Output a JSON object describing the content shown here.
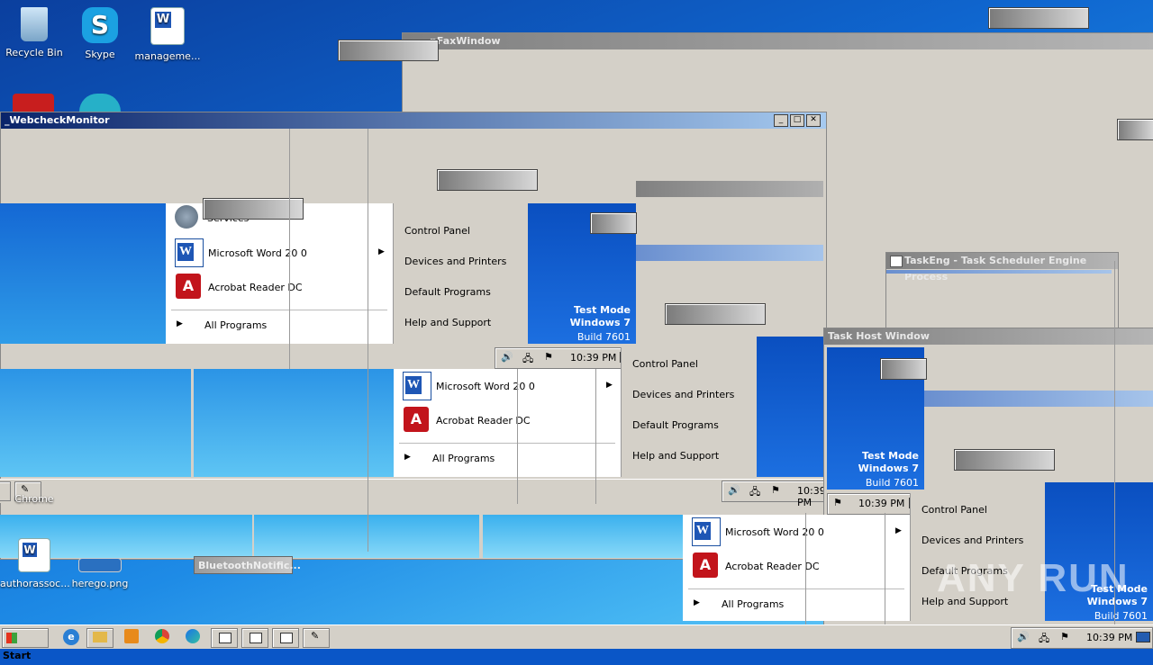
{
  "desktop": {
    "icons": [
      {
        "label": "Recycle Bin",
        "icon": "recycle-bin-icon"
      },
      {
        "label": "Skype",
        "icon": "skype-icon"
      },
      {
        "label": "manageme...",
        "icon": "word-doc-icon"
      },
      {
        "label": "Chrome",
        "icon": "chrome-icon"
      },
      {
        "label": "authorassoc...",
        "icon": "word-doc-icon"
      },
      {
        "label": "herego.png",
        "icon": "image-file-icon"
      }
    ]
  },
  "windows": {
    "fax": {
      "title": "nFaxWindow"
    },
    "webcheck": {
      "title": "_WebcheckMonitor"
    },
    "taskeng": {
      "title": "TaskEng - Task Scheduler Engine Process"
    },
    "taskhost": {
      "title": "Task Host Window"
    },
    "bluetooth": {
      "title": "BluetoothNotific..."
    }
  },
  "start_menu": {
    "services": "Services",
    "word": "Microsoft Word 20 0",
    "acrobat": "Acrobat Reader DC",
    "all_programs": "All Programs",
    "control_panel": "Control Panel",
    "devices": "Devices and Printers",
    "default_programs": "Default Programs",
    "help": "Help and Support"
  },
  "test_mode": {
    "line1": "Test Mode",
    "line2": "Windows 7",
    "line3": "Build 7601"
  },
  "tray": {
    "time": "10:39 PM"
  },
  "taskbar": {
    "start_label": "Start"
  },
  "watermark": {
    "text": "ANY RUN"
  }
}
